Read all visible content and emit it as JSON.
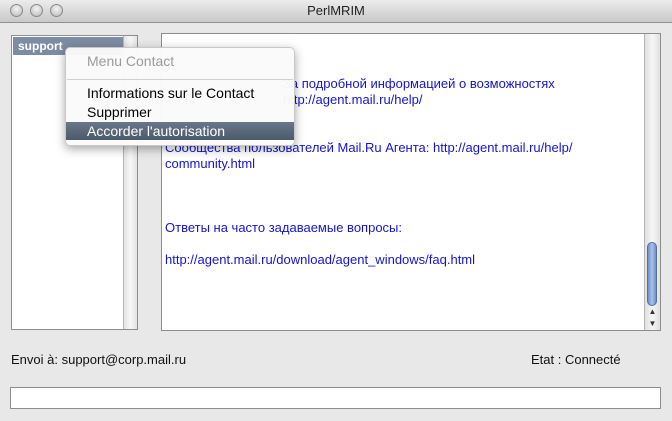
{
  "window": {
    "title": "PerlMRIM"
  },
  "contacts": {
    "items": [
      {
        "label": "support",
        "selected": true
      }
    ]
  },
  "messages": {
    "lines": [
      "За подробной информацией о возможностях",
      "http://agent.mail.ru/help/",
      "",
      "",
      "Сообщества пользователей Mail.Ru Агента: http://agent.mail.ru/help/",
      "community.html",
      "",
      "",
      "",
      "Ответы на часто задаваемые вопросы:",
      "",
      "http://agent.mail.ru/download/agent_windows/faq.html"
    ]
  },
  "status": {
    "send_to": "Envoi à: support@corp.mail.ru",
    "state": "Etat : Connecté"
  },
  "input": {
    "value": ""
  },
  "context_menu": {
    "header": "Menu Contact",
    "items": [
      {
        "label": "Informations sur le Contact"
      },
      {
        "label": "Supprimer"
      },
      {
        "label": "Accorder l'autorisation",
        "highlighted": true
      }
    ]
  },
  "colors": {
    "link_text": "#1414d2",
    "selection": "#7e8ca3",
    "menu_highlight": "#56657a"
  }
}
